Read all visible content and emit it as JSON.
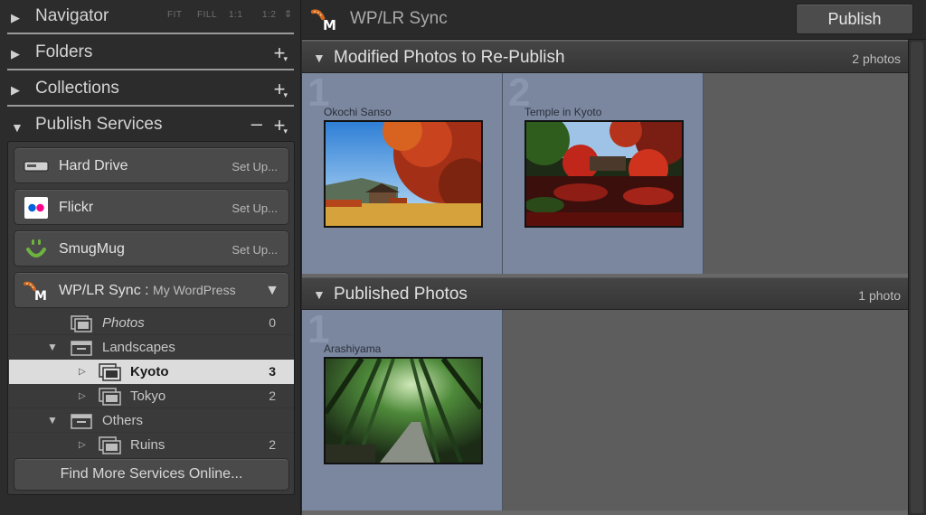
{
  "left": {
    "navigator": {
      "title": "Navigator",
      "zoom": [
        "FIT",
        "FILL",
        "1:1",
        "1:2"
      ]
    },
    "folders": {
      "title": "Folders"
    },
    "collections": {
      "title": "Collections"
    },
    "publish_services": {
      "title": "Publish Services",
      "services": [
        {
          "name": "Hard Drive",
          "action": "Set Up..."
        },
        {
          "name": "Flickr",
          "action": "Set Up..."
        },
        {
          "name": "SmugMug",
          "action": "Set Up..."
        },
        {
          "name": "WP/LR Sync",
          "separator": ":",
          "subtitle": "My WordPress"
        }
      ],
      "tree": [
        {
          "label": "Photos",
          "count": "0"
        },
        {
          "label": "Landscapes",
          "count": ""
        },
        {
          "label": "Kyoto",
          "count": "3"
        },
        {
          "label": "Tokyo",
          "count": "2"
        },
        {
          "label": "Others",
          "count": ""
        },
        {
          "label": "Ruins",
          "count": "2"
        }
      ],
      "find_more": "Find More Services Online..."
    }
  },
  "topbar": {
    "title": "WP/LR Sync",
    "publish_label": "Publish",
    "logo_letter": "M"
  },
  "sections": [
    {
      "title": "Modified Photos to Re-Publish",
      "count": "2 photos",
      "photos": [
        {
          "index": "1",
          "caption": "Okochi Sanso"
        },
        {
          "index": "2",
          "caption": "Temple in Kyoto"
        }
      ]
    },
    {
      "title": "Published Photos",
      "count": "1 photo",
      "photos": [
        {
          "index": "1",
          "caption": "Arashiyama"
        }
      ]
    }
  ],
  "colors": {
    "selection_cell": "#7a879f",
    "flickr_pink": "#ff0084",
    "flickr_blue": "#0063dc",
    "smugmug_green": "#6db33f"
  }
}
